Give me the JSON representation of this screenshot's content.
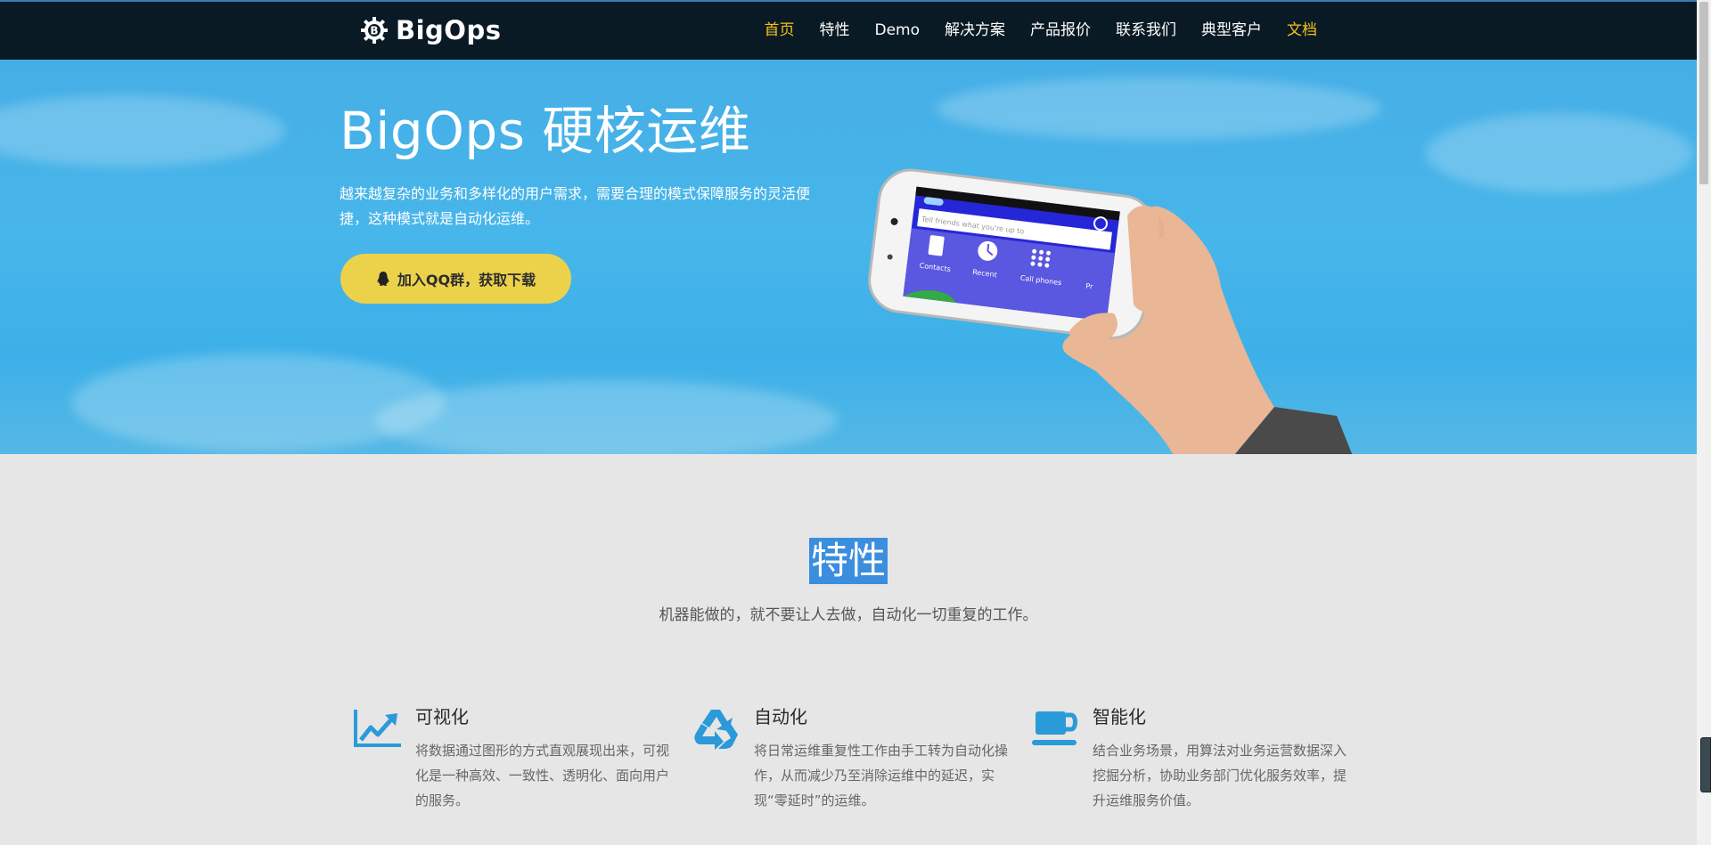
{
  "header": {
    "brand": "BigOps",
    "nav": [
      {
        "label": "首页"
      },
      {
        "label": "特性"
      },
      {
        "label": "Demo"
      },
      {
        "label": "解决方案"
      },
      {
        "label": "产品报价"
      },
      {
        "label": "联系我们"
      },
      {
        "label": "典型客户"
      },
      {
        "label": "文档"
      }
    ]
  },
  "hero": {
    "title": "BigOps  硬核运维",
    "description": "越来越复杂的业务和多样化的用户需求，需要合理的模式保障服务的灵活便捷，这种模式就是自动化运维。",
    "cta_label": "加入QQ群，获取下载",
    "phone_screen": {
      "search_placeholder": "Tell friends what you're up to",
      "apps": [
        "Contacts",
        "Recent",
        "Call phones",
        "Pr"
      ]
    }
  },
  "features": {
    "title": "特性",
    "subtitle": "机器能做的，就不要让人去做，自动化一切重复的工作。",
    "items": [
      {
        "icon": "line-chart-icon",
        "title": "可视化",
        "text": "将数据通过图形的方式直观展现出来，可视化是一种高效、一致性、透明化、面向用户的服务。"
      },
      {
        "icon": "recycle-icon",
        "title": "自动化",
        "text": "将日常运维重复性工作由手工转为自动化操作，从而减少乃至消除运维中的延迟，实现“零延时”的运维。"
      },
      {
        "icon": "coffee-cup-icon",
        "title": "智能化",
        "text": "结合业务场景，用算法对业务运营数据深入挖掘分析，协助业务部门优化服务效率，提升运维服务价值。"
      }
    ]
  },
  "colors": {
    "accent": "#f2c21a",
    "cta": "#ecd24a",
    "hero_bg": "#45aee6",
    "icon": "#2b9ad8",
    "header_bg": "#0a1a24"
  }
}
